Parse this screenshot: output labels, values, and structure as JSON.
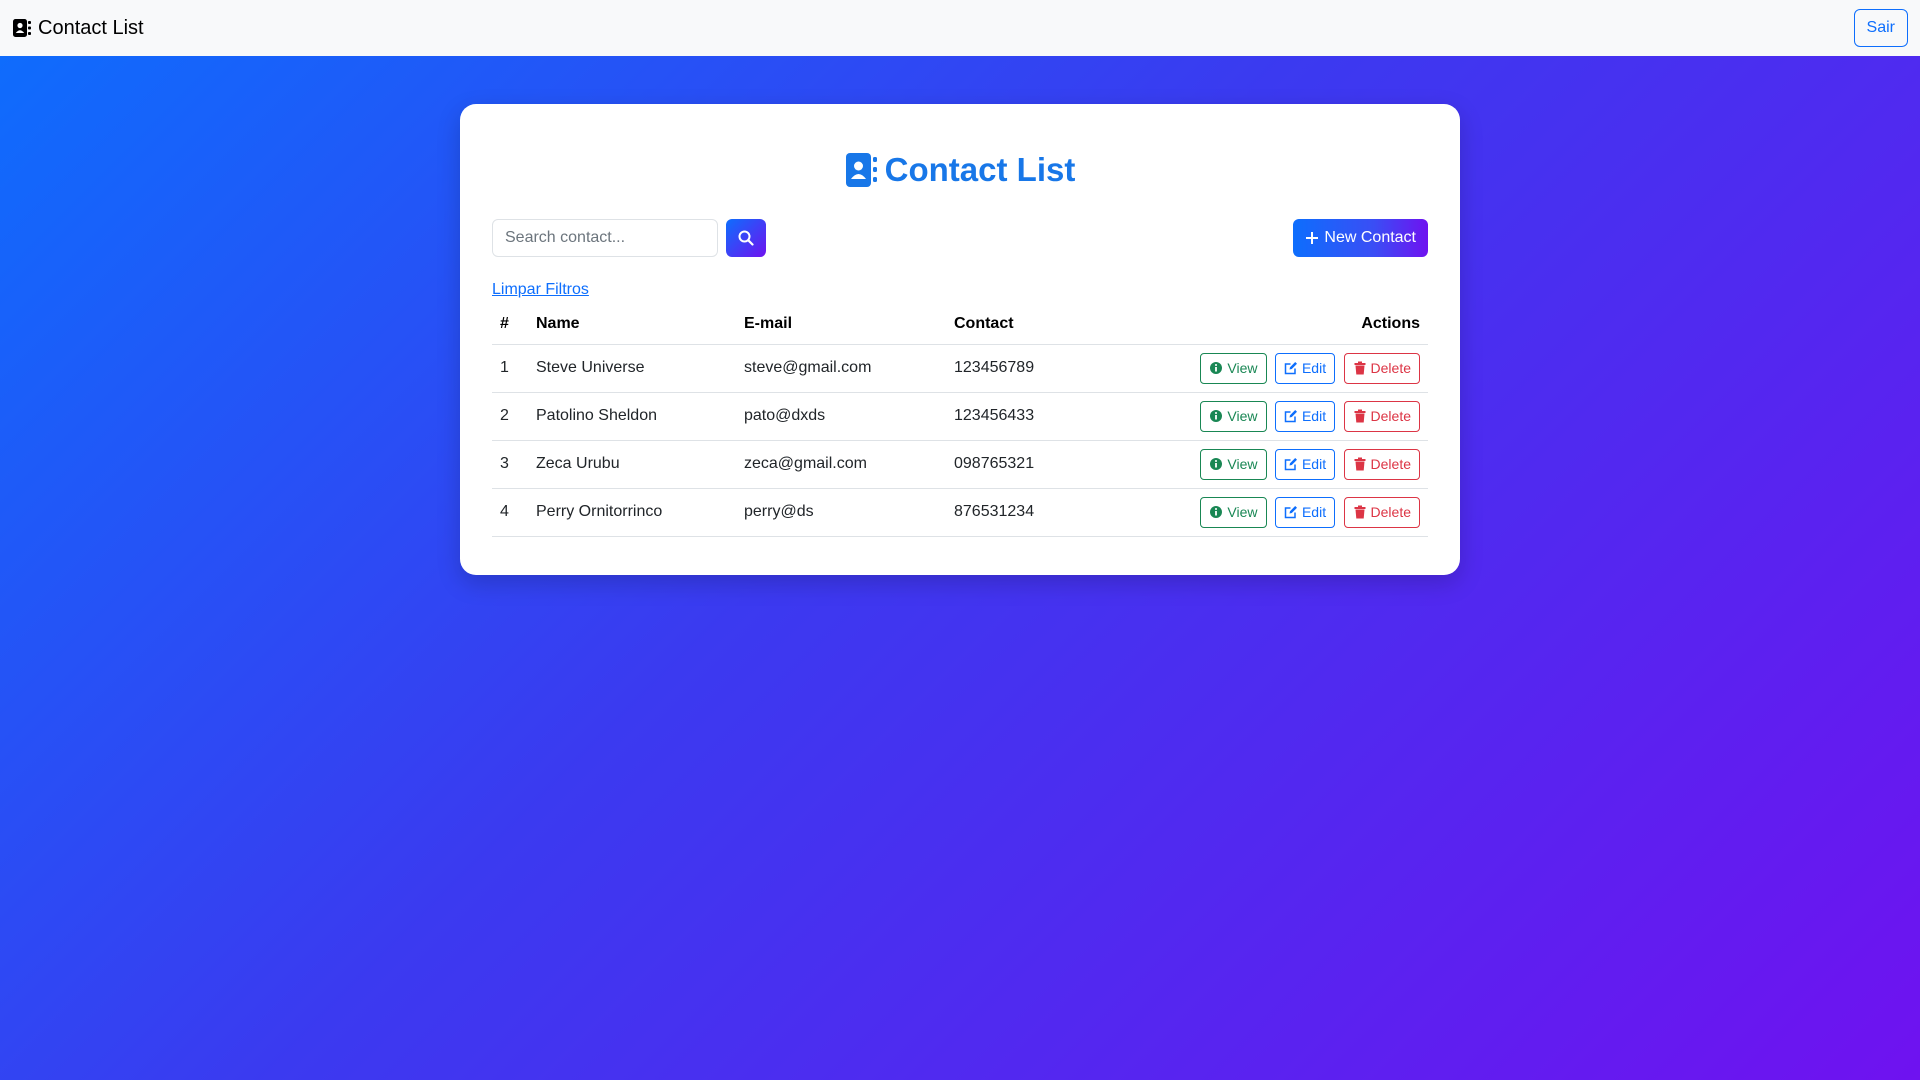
{
  "navbar": {
    "brand": "Contact List",
    "brand_icon": "address-book-icon",
    "logout_label": "Sair"
  },
  "main": {
    "title": "Contact List",
    "title_icon": "address-book-icon",
    "search_placeholder": "Search contact...",
    "search_value": "",
    "new_contact_label": "New Contact",
    "clear_filters_label": "Limpar Filtros"
  },
  "table": {
    "headers": [
      "#",
      "Name",
      "E-mail",
      "Contact",
      "Actions"
    ],
    "rows": [
      {
        "id": "1",
        "name": "Steve Universe",
        "email": "steve@gmail.com",
        "contact": "123456789"
      },
      {
        "id": "2",
        "name": "Patolino Sheldon",
        "email": "pato@dxds",
        "contact": "123456433"
      },
      {
        "id": "3",
        "name": "Zeca Urubu",
        "email": "zeca@gmail.com",
        "contact": "098765321"
      },
      {
        "id": "4",
        "name": "Perry Ornitorrinco",
        "email": "perry@ds",
        "contact": "876531234"
      }
    ],
    "actions": {
      "view": "View",
      "edit": "Edit",
      "delete": "Delete"
    }
  },
  "colors": {
    "primary": "#0d6efd",
    "title": "#1877e8",
    "success": "#198754",
    "danger": "#dc3545",
    "gradient_start": "#0d6efd",
    "gradient_end": "#6f12f0"
  }
}
